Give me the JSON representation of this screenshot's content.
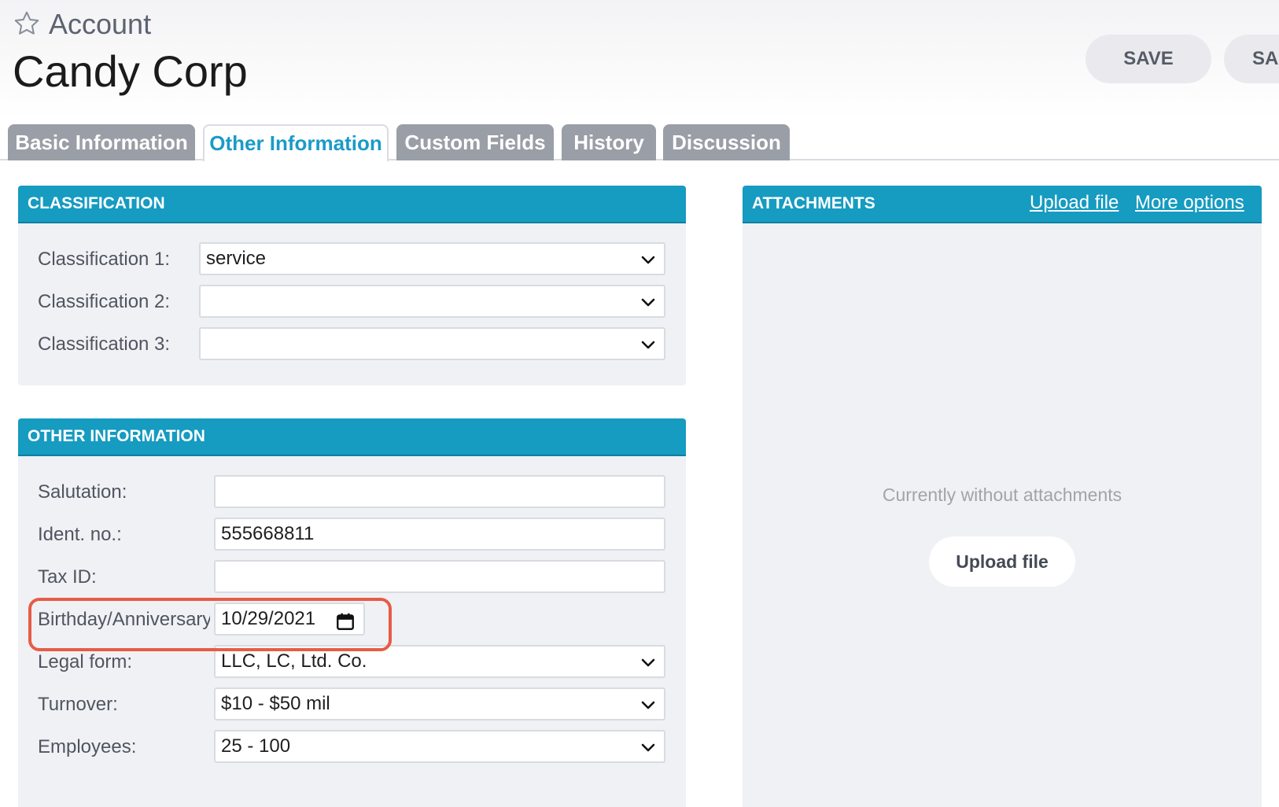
{
  "header": {
    "entity_type": "Account",
    "record_name": "Candy Corp",
    "save_label": "SAVE",
    "save_close_label": "SA"
  },
  "tabs": [
    {
      "label": "Basic Information",
      "active": false
    },
    {
      "label": "Other Information",
      "active": true
    },
    {
      "label": "Custom Fields",
      "active": false
    },
    {
      "label": "History",
      "active": false
    },
    {
      "label": "Discussion",
      "active": false
    }
  ],
  "classification": {
    "title": "CLASSIFICATION",
    "fields": [
      {
        "label": "Classification 1:",
        "value": "service"
      },
      {
        "label": "Classification 2:",
        "value": ""
      },
      {
        "label": "Classification 3:",
        "value": ""
      }
    ]
  },
  "other_info": {
    "title": "OTHER INFORMATION",
    "salutation": {
      "label": "Salutation:",
      "value": ""
    },
    "ident_no": {
      "label": "Ident. no.:",
      "value": "555668811"
    },
    "tax_id": {
      "label": "Tax ID:",
      "value": ""
    },
    "birthday": {
      "label": "Birthday/Anniversary:",
      "value": "10/29/2021"
    },
    "legal_form": {
      "label": "Legal form:",
      "value": "LLC, LC, Ltd. Co."
    },
    "turnover": {
      "label": "Turnover:",
      "value": "$10 - $50 mil"
    },
    "employees": {
      "label": "Employees:",
      "value": "25 - 100"
    }
  },
  "attachments": {
    "title": "ATTACHMENTS",
    "upload_link": "Upload file",
    "more_options_link": "More options",
    "empty_text": "Currently without attachments",
    "upload_button": "Upload file"
  },
  "colors": {
    "accent": "#169bc1",
    "highlight": "#e65c47",
    "tab_inactive": "#9a9ea6"
  },
  "icons": [
    "star-icon",
    "chevron-down-icon",
    "calendar-icon"
  ]
}
